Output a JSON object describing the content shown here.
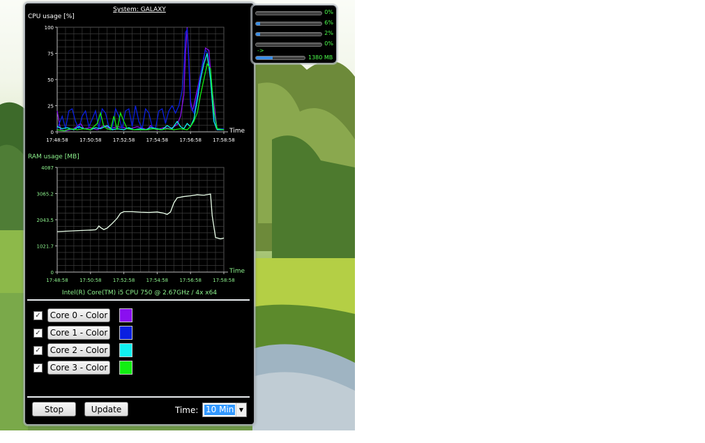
{
  "window": {
    "title": "System: GALAXY"
  },
  "cpu_chart": {
    "title": "CPU usage [%]",
    "time_label": "Time",
    "y_ticks": [
      "100",
      "75",
      "50",
      "25",
      "0"
    ],
    "x_ticks": [
      "17:48:58",
      "17:50:58",
      "17:52:58",
      "17:54:58",
      "17:56:58",
      "17:58:58"
    ]
  },
  "ram_chart": {
    "title": "RAM usage [MB]",
    "time_label": "Time",
    "y_ticks": [
      "4087",
      "3065.2",
      "2043.5",
      "1021.7",
      "0"
    ],
    "x_ticks": [
      "17:48:58",
      "17:50:58",
      "17:52:58",
      "17:54:58",
      "17:56:58",
      "17:58:58"
    ]
  },
  "cpu_info": "Intel(R) Core(TM) i5 CPU 750 @ 2.67GHz / 4x x64",
  "cores": [
    {
      "label": "Core 0 - Color",
      "checked": "✓",
      "color": "#8a0ff0"
    },
    {
      "label": "Core 1 - Color",
      "checked": "✓",
      "color": "#0a1fe0"
    },
    {
      "label": "Core 2 - Color",
      "checked": "✓",
      "color": "#12f0f0"
    },
    {
      "label": "Core 3 - Color",
      "checked": "✓",
      "color": "#12ee12"
    }
  ],
  "controls": {
    "stop_label": "Stop",
    "update_label": "Update",
    "time_label": "Time:",
    "time_value": "10 Min"
  },
  "mini_meter": {
    "cores": [
      {
        "value_label": "0%",
        "fraction": 0.0
      },
      {
        "value_label": "6%",
        "fraction": 0.06
      },
      {
        "value_label": "2%",
        "fraction": 0.02
      },
      {
        "value_label": "0%",
        "fraction": 0.0
      }
    ],
    "arrow": "->",
    "ram_label": "1380 MB",
    "ram_fraction": 0.34
  },
  "chart_data": [
    {
      "type": "line",
      "title": "CPU usage [%]",
      "xlabel": "Time",
      "ylabel": "",
      "x_range": [
        "17:48:58",
        "17:58:58"
      ],
      "ylim": [
        0,
        100
      ],
      "grid": true,
      "series": [
        {
          "color": "#8a0ff0",
          "points": [
            [
              0,
              20
            ],
            [
              0.2,
              2
            ],
            [
              0.5,
              1
            ],
            [
              1,
              3
            ],
            [
              1.4,
              8
            ],
            [
              1.6,
              3
            ],
            [
              2,
              4
            ],
            [
              2.4,
              2
            ],
            [
              2.8,
              6
            ],
            [
              3.2,
              3
            ],
            [
              3.6,
              5
            ],
            [
              4,
              4
            ],
            [
              4.4,
              3
            ],
            [
              4.8,
              5
            ],
            [
              5.2,
              3
            ],
            [
              5.4,
              2
            ],
            [
              5.6,
              6
            ],
            [
              5.8,
              3
            ],
            [
              6,
              2
            ],
            [
              6.4,
              4
            ],
            [
              6.8,
              3
            ],
            [
              7,
              5
            ],
            [
              7.2,
              7
            ],
            [
              7.4,
              15
            ],
            [
              7.6,
              35
            ],
            [
              7.7,
              75
            ],
            [
              7.8,
              100
            ],
            [
              7.9,
              70
            ],
            [
              8.0,
              30
            ],
            [
              8.1,
              20
            ],
            [
              8.2,
              25
            ],
            [
              8.4,
              40
            ],
            [
              8.6,
              55
            ],
            [
              8.8,
              70
            ],
            [
              8.9,
              80
            ],
            [
              9.1,
              78
            ],
            [
              9.3,
              40
            ],
            [
              9.6,
              2
            ],
            [
              10,
              2
            ]
          ]
        },
        {
          "color": "#0a1fe0",
          "points": [
            [
              0,
              3
            ],
            [
              0.3,
              15
            ],
            [
              0.5,
              3
            ],
            [
              0.7,
              20
            ],
            [
              0.9,
              22
            ],
            [
              1.1,
              10
            ],
            [
              1.3,
              3
            ],
            [
              1.5,
              15
            ],
            [
              1.7,
              20
            ],
            [
              1.9,
              5
            ],
            [
              2.1,
              12
            ],
            [
              2.3,
              20
            ],
            [
              2.5,
              3
            ],
            [
              2.7,
              22
            ],
            [
              2.9,
              18
            ],
            [
              3.1,
              5
            ],
            [
              3.3,
              3
            ],
            [
              3.5,
              22
            ],
            [
              3.7,
              15
            ],
            [
              3.9,
              3
            ],
            [
              4.1,
              20
            ],
            [
              4.3,
              22
            ],
            [
              4.5,
              5
            ],
            [
              4.7,
              25
            ],
            [
              4.9,
              10
            ],
            [
              5.1,
              3
            ],
            [
              5.3,
              22
            ],
            [
              5.5,
              18
            ],
            [
              5.7,
              5
            ],
            [
              5.9,
              3
            ],
            [
              6.1,
              20
            ],
            [
              6.3,
              22
            ],
            [
              6.5,
              8
            ],
            [
              6.7,
              20
            ],
            [
              6.9,
              25
            ],
            [
              7.1,
              18
            ],
            [
              7.3,
              25
            ],
            [
              7.5,
              40
            ],
            [
              7.6,
              60
            ],
            [
              7.7,
              95
            ],
            [
              7.8,
              98
            ],
            [
              7.9,
              65
            ],
            [
              8.0,
              25
            ],
            [
              8.2,
              18
            ],
            [
              8.4,
              35
            ],
            [
              8.6,
              55
            ],
            [
              8.8,
              72
            ],
            [
              8.9,
              78
            ],
            [
              9.0,
              76
            ],
            [
              9.2,
              55
            ],
            [
              9.4,
              15
            ],
            [
              9.6,
              3
            ],
            [
              10,
              3
            ]
          ]
        },
        {
          "color": "#12f0f0",
          "points": [
            [
              0,
              5
            ],
            [
              0.3,
              3
            ],
            [
              0.6,
              4
            ],
            [
              1,
              2
            ],
            [
              1.3,
              5
            ],
            [
              1.6,
              3
            ],
            [
              2,
              2
            ],
            [
              2.3,
              4
            ],
            [
              2.6,
              3
            ],
            [
              3,
              6
            ],
            [
              3.3,
              2
            ],
            [
              3.6,
              3
            ],
            [
              4,
              2
            ],
            [
              4.3,
              4
            ],
            [
              4.6,
              2
            ],
            [
              5,
              3
            ],
            [
              5.3,
              2
            ],
            [
              5.6,
              4
            ],
            [
              6,
              3
            ],
            [
              6.3,
              2
            ],
            [
              6.6,
              6
            ],
            [
              6.9,
              3
            ],
            [
              7.2,
              10
            ],
            [
              7.4,
              5
            ],
            [
              7.6,
              3
            ],
            [
              7.8,
              8
            ],
            [
              8,
              5
            ],
            [
              8.2,
              12
            ],
            [
              8.4,
              30
            ],
            [
              8.6,
              50
            ],
            [
              8.8,
              65
            ],
            [
              9.0,
              75
            ],
            [
              9.2,
              50
            ],
            [
              9.4,
              10
            ],
            [
              9.6,
              2
            ],
            [
              10,
              2
            ]
          ]
        },
        {
          "color": "#12ee12",
          "points": [
            [
              0,
              2
            ],
            [
              0.4,
              1
            ],
            [
              0.8,
              3
            ],
            [
              1.2,
              2
            ],
            [
              1.6,
              3
            ],
            [
              2.0,
              2
            ],
            [
              2.4,
              8
            ],
            [
              2.6,
              18
            ],
            [
              2.8,
              5
            ],
            [
              3.0,
              3
            ],
            [
              3.2,
              2
            ],
            [
              3.4,
              15
            ],
            [
              3.6,
              2
            ],
            [
              3.8,
              18
            ],
            [
              4.0,
              10
            ],
            [
              4.2,
              3
            ],
            [
              4.6,
              2
            ],
            [
              5.0,
              2
            ],
            [
              5.4,
              2
            ],
            [
              5.8,
              3
            ],
            [
              6.2,
              2
            ],
            [
              6.6,
              3
            ],
            [
              7.0,
              2
            ],
            [
              7.4,
              3
            ],
            [
              7.8,
              2
            ],
            [
              8.0,
              5
            ],
            [
              8.2,
              10
            ],
            [
              8.4,
              18
            ],
            [
              8.6,
              35
            ],
            [
              8.8,
              50
            ],
            [
              9.0,
              65
            ],
            [
              9.2,
              60
            ],
            [
              9.4,
              20
            ],
            [
              9.6,
              3
            ],
            [
              10,
              2
            ]
          ]
        }
      ]
    },
    {
      "type": "line",
      "title": "RAM usage [MB]",
      "xlabel": "Time",
      "ylabel": "",
      "x_range": [
        "17:48:58",
        "17:58:58"
      ],
      "ylim": [
        0,
        4087
      ],
      "grid": true,
      "series": [
        {
          "color": "#eaffea",
          "points": [
            [
              0,
              1580
            ],
            [
              1,
              1610
            ],
            [
              2,
              1640
            ],
            [
              2.3,
              1650
            ],
            [
              2.4,
              1700
            ],
            [
              2.5,
              1800
            ],
            [
              2.6,
              1740
            ],
            [
              2.8,
              1660
            ],
            [
              3.0,
              1720
            ],
            [
              3.3,
              1900
            ],
            [
              3.6,
              2100
            ],
            [
              3.8,
              2300
            ],
            [
              4.0,
              2360
            ],
            [
              4.5,
              2360
            ],
            [
              5.0,
              2340
            ],
            [
              5.5,
              2330
            ],
            [
              6.0,
              2350
            ],
            [
              6.4,
              2300
            ],
            [
              6.6,
              2250
            ],
            [
              6.8,
              2350
            ],
            [
              7.0,
              2700
            ],
            [
              7.2,
              2900
            ],
            [
              7.6,
              2950
            ],
            [
              8.0,
              2980
            ],
            [
              8.4,
              3020
            ],
            [
              8.8,
              3000
            ],
            [
              9.2,
              3050
            ],
            [
              9.3,
              2200
            ],
            [
              9.5,
              1350
            ],
            [
              9.8,
              1300
            ],
            [
              10,
              1330
            ]
          ]
        }
      ]
    }
  ]
}
